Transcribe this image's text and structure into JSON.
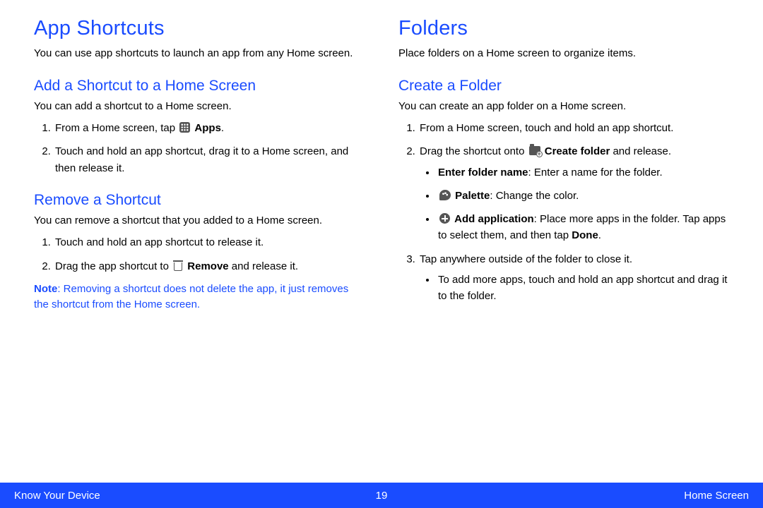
{
  "left": {
    "h1": "App Shortcuts",
    "intro": "You can use app shortcuts to launch an app from any Home screen.",
    "sec1": {
      "title": "Add a Shortcut to a Home Screen",
      "intro": "You can add a shortcut to a Home screen.",
      "step1_a": "From a Home screen, tap ",
      "step1_b": "Apps",
      "step1_c": ".",
      "step2": "Touch and hold an app shortcut, drag it to a Home screen, and then release it."
    },
    "sec2": {
      "title": "Remove a Shortcut",
      "intro": "You can remove a shortcut that you added to a Home screen.",
      "step1": "Touch and hold an app shortcut to release it.",
      "step2_a": "Drag the app shortcut to ",
      "step2_b": "Remove",
      "step2_c": " and release it."
    },
    "note_label": "Note",
    "note_text": ": Removing a shortcut does not delete the app, it just removes the shortcut from the Home screen."
  },
  "right": {
    "h1": "Folders",
    "intro": "Place folders on a Home screen to organize items.",
    "sec1": {
      "title": "Create a Folder",
      "intro": "You can create an app folder on a Home screen.",
      "step1": "From a Home screen, touch and hold an app shortcut.",
      "step2_a": "Drag the shortcut onto ",
      "step2_b": "Create folder",
      "step2_c": " and release.",
      "b1_label": "Enter folder name",
      "b1_text": ": Enter a name for the folder.",
      "b2_label": "Palette",
      "b2_text": ": Change the color.",
      "b3_label": "Add application",
      "b3_text_a": ": Place more apps in the folder. Tap apps to select them, and then tap ",
      "b3_done": "Done",
      "b3_text_b": ".",
      "step3": "Tap anywhere outside of the folder to close it.",
      "b4": "To add more apps, touch and hold an app shortcut and drag it to the folder."
    }
  },
  "footer": {
    "left": "Know Your Device",
    "page": "19",
    "right": "Home Screen"
  }
}
